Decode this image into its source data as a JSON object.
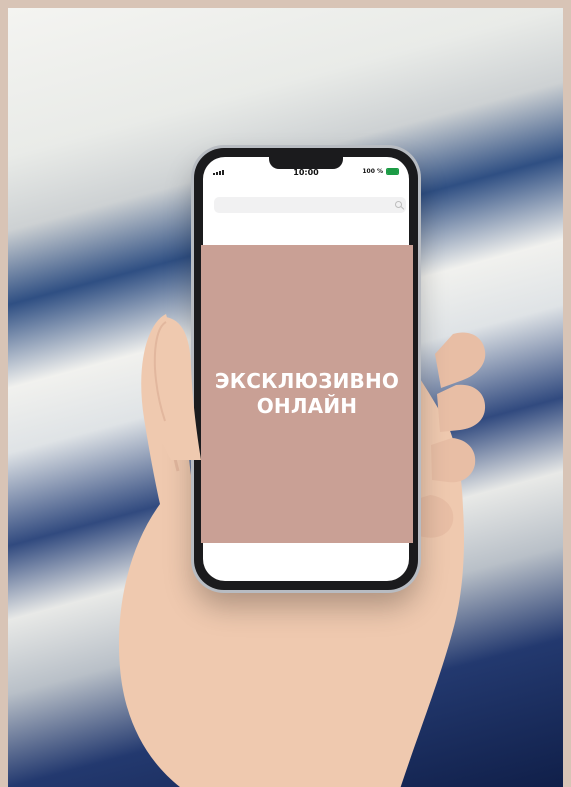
{
  "phone": {
    "status_time": "10:00",
    "battery_label": "100 %",
    "battery_level": 1.0
  },
  "promo": {
    "title_line_1": "ЭКСКЛЮЗИВНО",
    "title_line_2": "ОНЛАЙН"
  },
  "colors": {
    "frame": "#d8c4b6",
    "promo_panel": "#c9a095",
    "promo_text": "#ffffff",
    "phone_body": "#1b1b1d",
    "battery_green": "#1c9b45"
  },
  "icons": {
    "signal": "signal-icon",
    "battery": "battery-icon",
    "search": "search-icon"
  }
}
